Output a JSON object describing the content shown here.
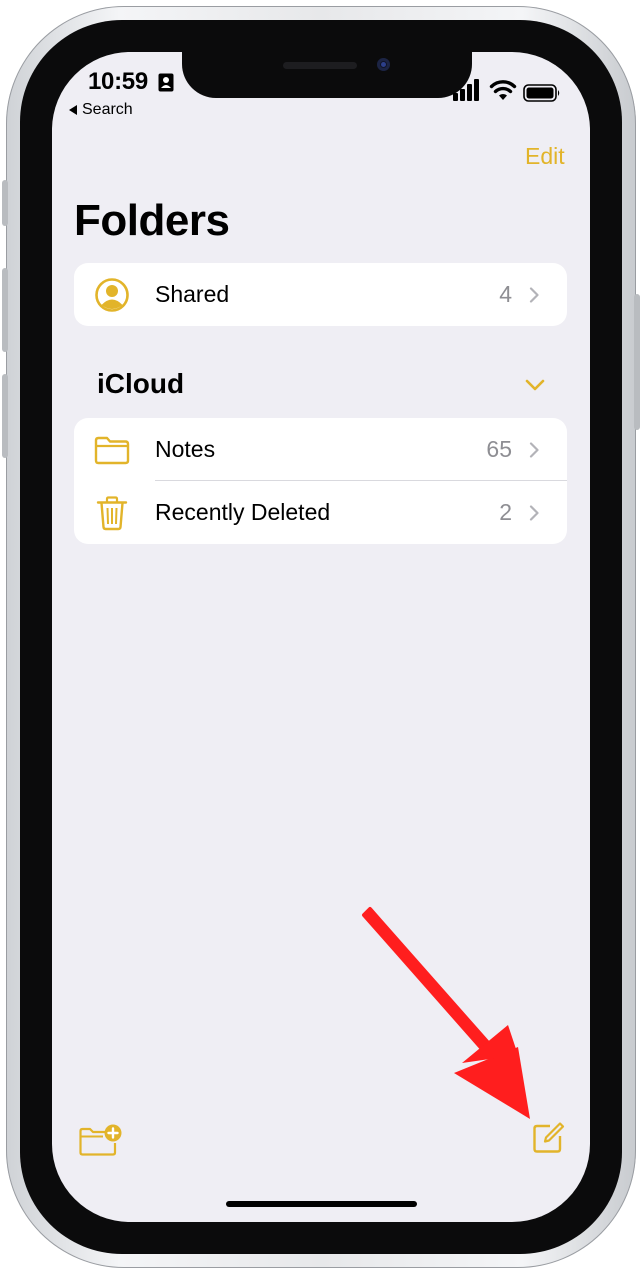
{
  "status_bar": {
    "time": "10:59",
    "back_label": "Search"
  },
  "nav": {
    "edit_label": "Edit",
    "title": "Folders"
  },
  "shared": {
    "label": "Shared",
    "count": "4",
    "icon": "person-circle-icon"
  },
  "icloud": {
    "section_title": "iCloud",
    "folders": [
      {
        "label": "Notes",
        "count": "65",
        "icon": "folder-icon"
      },
      {
        "label": "Recently Deleted",
        "count": "2",
        "icon": "trash-icon"
      }
    ]
  },
  "toolbar": {
    "left_icon": "new-folder-icon",
    "right_icon": "compose-icon"
  },
  "colors": {
    "accent": "#e2b42a",
    "background": "#efeef4",
    "annotation": "#ff1e1e"
  }
}
